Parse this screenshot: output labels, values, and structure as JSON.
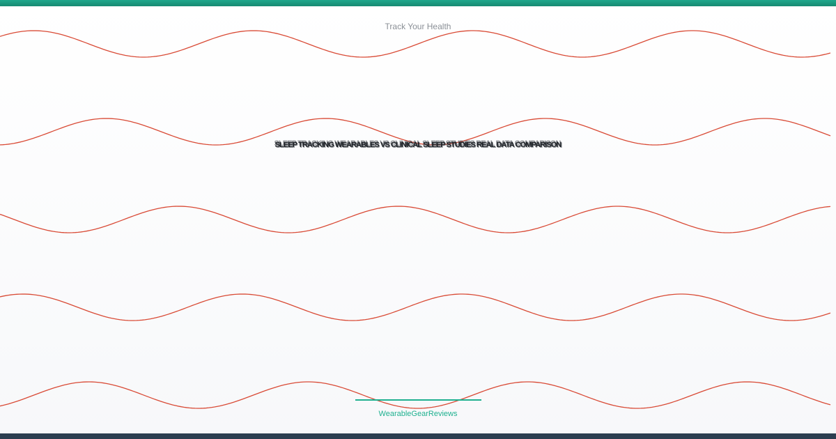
{
  "tagline": "Track Your Health",
  "headline": "SLEEP TRACKING WEARABLES VS CLINICAL SLEEP STUDIES REAL DATA COMPARISON",
  "brand": "WearableGearReviews",
  "colors": {
    "accent": "#1fb08f",
    "wave": "#d94a35",
    "footer": "#2c3e50"
  }
}
